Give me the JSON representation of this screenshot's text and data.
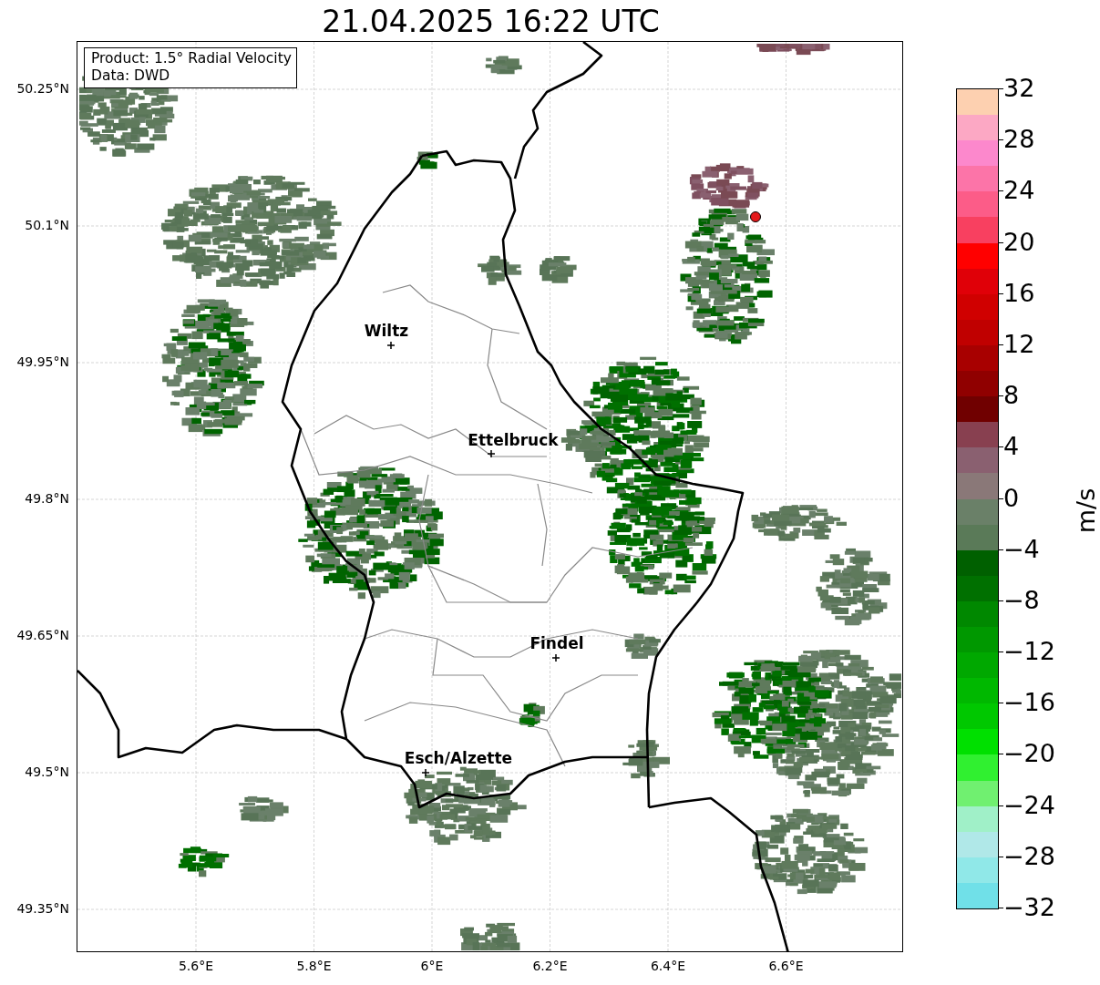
{
  "title": "21.04.2025 16:22 UTC",
  "info_box": {
    "lines": [
      "Product: 1.5° Radial Velocity",
      "Data: DWD"
    ]
  },
  "map": {
    "y_ticks": [
      "50.25°N",
      "50.1°N",
      "49.95°N",
      "49.8°N",
      "49.65°N",
      "49.5°N",
      "49.35°N"
    ],
    "x_ticks": [
      "5.6°E",
      "5.8°E",
      "6°E",
      "6.2°E",
      "6.4°E",
      "6.6°E"
    ],
    "cities": [
      {
        "name": "Wiltz"
      },
      {
        "name": "Ettelbruck"
      },
      {
        "name": "Findel"
      },
      {
        "name": "Esch/Alzette"
      }
    ]
  },
  "colorbar": {
    "label": "m/s",
    "ticks": [
      "32",
      "28",
      "24",
      "20",
      "16",
      "12",
      "8",
      "4",
      "0",
      "−4",
      "−8",
      "−12",
      "−16",
      "−20",
      "−24",
      "−28",
      "−32"
    ],
    "segments": [
      {
        "color": "#fdd0b0"
      },
      {
        "color": "#fca8c4"
      },
      {
        "color": "#fc88cc"
      },
      {
        "color": "#fc74a8"
      },
      {
        "color": "#fc5c88"
      },
      {
        "color": "#f84060"
      },
      {
        "color": "#ff0000"
      },
      {
        "color": "#e00008"
      },
      {
        "color": "#d00000"
      },
      {
        "color": "#c00000"
      },
      {
        "color": "#a80000"
      },
      {
        "color": "#900000"
      },
      {
        "color": "#700000"
      },
      {
        "color": "#884050"
      },
      {
        "color": "#8a6070"
      },
      {
        "color": "#8a7878"
      },
      {
        "color": "#6a8068"
      },
      {
        "color": "#5a7a58"
      },
      {
        "color": "#006000"
      },
      {
        "color": "#007000"
      },
      {
        "color": "#008800"
      },
      {
        "color": "#009800"
      },
      {
        "color": "#00a800"
      },
      {
        "color": "#00b800"
      },
      {
        "color": "#00c800"
      },
      {
        "color": "#00e000"
      },
      {
        "color": "#30f030"
      },
      {
        "color": "#70f070"
      },
      {
        "color": "#a0f0c8"
      },
      {
        "color": "#b0e8e8"
      },
      {
        "color": "#90e8e8"
      },
      {
        "color": "#70e0e8"
      }
    ]
  }
}
